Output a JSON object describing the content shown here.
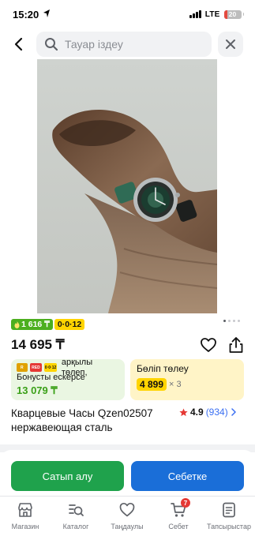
{
  "status_bar": {
    "time": "15:20",
    "network": "LTE",
    "battery": "20",
    "battery_level": 0.2,
    "icons": [
      "location-arrow-icon",
      "signal-icon",
      "battery-icon"
    ]
  },
  "header": {
    "search_placeholder": "Тауар іздеу",
    "icons": [
      "back-arrow-icon",
      "search-icon",
      "close-icon"
    ]
  },
  "product": {
    "gallery": {
      "count": 4,
      "active": 1
    },
    "badges": {
      "bonus": "1 616 ₸",
      "installment": "0·0·12"
    },
    "price": "14 695 ₸",
    "bonus_card": {
      "logos": [
        "R",
        "RED",
        "0·0·12"
      ],
      "line1": "арқылы төлеп,",
      "line2": "Бонусты ескерсе",
      "amount": "13 079 ₸"
    },
    "installment_card": {
      "title": "Бөліп төлеу",
      "amount": "4 899",
      "multiplier": "× 3"
    },
    "title": "Кварцевые Часы Qzen02507 нержавеющая сталь",
    "rating": {
      "value": "4.9",
      "count": "(934)"
    }
  },
  "actions": {
    "buy": "Сатып алу",
    "cart": "Себетке"
  },
  "tabs": [
    {
      "label": "Магазин",
      "icon": "store-icon"
    },
    {
      "label": "Каталог",
      "icon": "catalog-icon"
    },
    {
      "label": "Таңдаулы",
      "icon": "heart-icon"
    },
    {
      "label": "Себет",
      "icon": "cart-icon",
      "badge": "7"
    },
    {
      "label": "Тапсырыстар",
      "icon": "orders-icon"
    }
  ],
  "colors": {
    "green": "#1fa24c",
    "blue": "#1a6ed8",
    "yellow": "#ffd400",
    "badge_green": "#4caf1f",
    "link_blue": "#3a6ff2"
  }
}
